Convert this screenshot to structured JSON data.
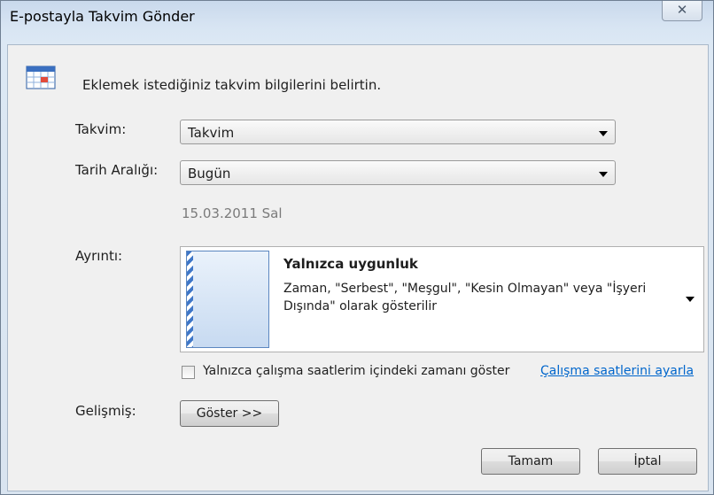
{
  "window": {
    "title": "E-postayla Takvim Gönder",
    "close_glyph": "✕"
  },
  "intro": {
    "icon": "calendar-icon",
    "text": "Eklemek istediğiniz takvim bilgilerini belirtin."
  },
  "calendar": {
    "label": "Takvim:",
    "value": "Takvim"
  },
  "date_range": {
    "label": "Tarih Aralığı:",
    "value": "Bugün",
    "date_text": "15.03.2011 Sal"
  },
  "detail": {
    "label": "Ayrıntı:",
    "title": "Yalnızca uygunluk",
    "description": "Zaman, \"Serbest\", \"Meşgul\", \"Kesin Olmayan\" veya \"İşyeri Dışında\" olarak gösterilir"
  },
  "working_hours": {
    "checkbox_label": "Yalnızca çalışma saatlerim içindeki zamanı göster",
    "checked": false,
    "link": "Çalışma saatlerini ayarla"
  },
  "advanced": {
    "label": "Gelişmiş:",
    "button": "Göster >>"
  },
  "footer": {
    "ok": "Tamam",
    "cancel": "İptal"
  }
}
